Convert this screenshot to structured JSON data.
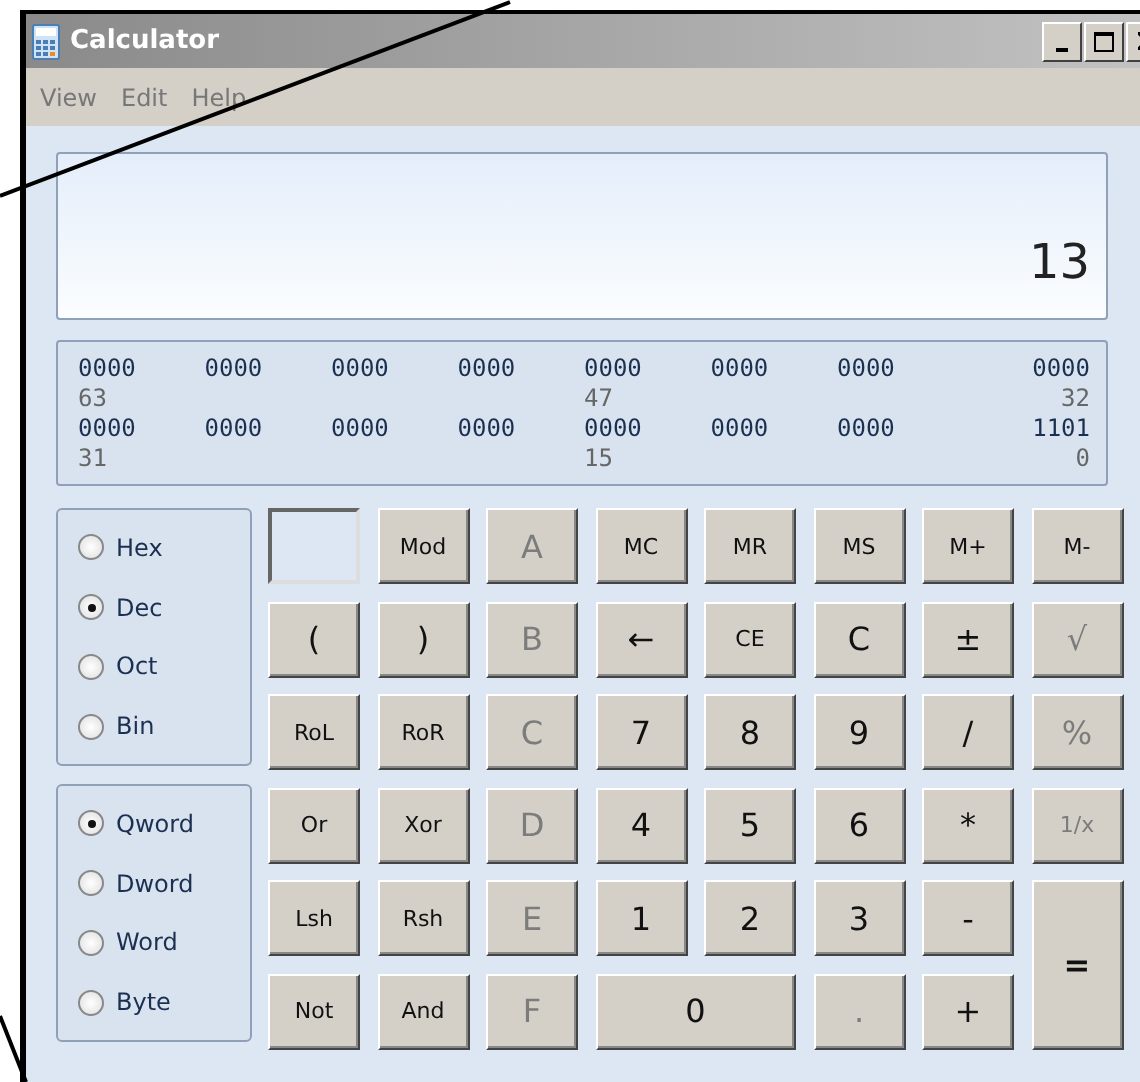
{
  "window": {
    "title": "Calculator"
  },
  "menu": [
    "View",
    "Edit",
    "Help"
  ],
  "display": {
    "value": "13"
  },
  "binary": [
    {
      "groups": [
        "0000",
        "0000",
        "0000",
        "0000",
        "0000",
        "0000",
        "0000",
        "0000"
      ],
      "positions": [
        "63",
        "47",
        "32"
      ]
    },
    {
      "groups": [
        "0000",
        "0000",
        "0000",
        "0000",
        "0000",
        "0000",
        "0000",
        "1101"
      ],
      "positions": [
        "31",
        "15",
        "0"
      ]
    }
  ],
  "base": [
    {
      "label": "Hex",
      "selected": false
    },
    {
      "label": "Dec",
      "selected": true
    },
    {
      "label": "Oct",
      "selected": false
    },
    {
      "label": "Bin",
      "selected": false
    }
  ],
  "word_size": [
    {
      "label": "Qword",
      "selected": true
    },
    {
      "label": "Dword",
      "selected": false
    },
    {
      "label": "Word",
      "selected": false
    },
    {
      "label": "Byte",
      "selected": false
    }
  ],
  "keys": [
    {
      "kind": "indicator"
    },
    {
      "kind": "key",
      "label": "Mod",
      "disabled": false
    },
    {
      "kind": "key",
      "label": "A",
      "disabled": true
    },
    {
      "kind": "key",
      "label": "MC",
      "disabled": false
    },
    {
      "kind": "key",
      "label": "MR",
      "disabled": false
    },
    {
      "kind": "key",
      "label": "MS",
      "disabled": false
    },
    {
      "kind": "key",
      "label": "M+",
      "disabled": false
    },
    {
      "kind": "key",
      "label": "M-",
      "disabled": false
    },
    {
      "kind": "key",
      "label": "(",
      "disabled": false
    },
    {
      "kind": "key",
      "label": ")",
      "disabled": false
    },
    {
      "kind": "key",
      "label": "B",
      "disabled": true
    },
    {
      "kind": "key",
      "label": "←",
      "disabled": false
    },
    {
      "kind": "key",
      "label": "CE",
      "disabled": false
    },
    {
      "kind": "key",
      "label": "C",
      "disabled": false
    },
    {
      "kind": "key",
      "label": "±",
      "disabled": false
    },
    {
      "kind": "key",
      "label": "√",
      "disabled": true
    },
    {
      "kind": "key",
      "label": "RoL",
      "disabled": false
    },
    {
      "kind": "key",
      "label": "RoR",
      "disabled": false
    },
    {
      "kind": "key",
      "label": "C",
      "disabled": true
    },
    {
      "kind": "key",
      "label": "7",
      "disabled": false
    },
    {
      "kind": "key",
      "label": "8",
      "disabled": false
    },
    {
      "kind": "key",
      "label": "9",
      "disabled": false
    },
    {
      "kind": "key",
      "label": "/",
      "disabled": false
    },
    {
      "kind": "key",
      "label": "%",
      "disabled": true
    },
    {
      "kind": "key",
      "label": "Or",
      "disabled": false
    },
    {
      "kind": "key",
      "label": "Xor",
      "disabled": false
    },
    {
      "kind": "key",
      "label": "D",
      "disabled": true
    },
    {
      "kind": "key",
      "label": "4",
      "disabled": false
    },
    {
      "kind": "key",
      "label": "5",
      "disabled": false
    },
    {
      "kind": "key",
      "label": "6",
      "disabled": false
    },
    {
      "kind": "key",
      "label": "*",
      "disabled": false
    },
    {
      "kind": "key",
      "label": "1/x",
      "disabled": true
    },
    {
      "kind": "key",
      "label": "Lsh",
      "disabled": false
    },
    {
      "kind": "key",
      "label": "Rsh",
      "disabled": false
    },
    {
      "kind": "key",
      "label": "E",
      "disabled": true
    },
    {
      "kind": "key",
      "label": "1",
      "disabled": false
    },
    {
      "kind": "key",
      "label": "2",
      "disabled": false
    },
    {
      "kind": "key",
      "label": "3",
      "disabled": false
    },
    {
      "kind": "key",
      "label": "-",
      "disabled": false
    },
    {
      "kind": "tall",
      "label": "=",
      "disabled": false
    },
    {
      "kind": "key",
      "label": "Not",
      "disabled": false
    },
    {
      "kind": "key",
      "label": "And",
      "disabled": false
    },
    {
      "kind": "key",
      "label": "F",
      "disabled": true
    },
    {
      "kind": "wide",
      "label": "0",
      "disabled": false
    },
    {
      "kind": "key",
      "label": ".",
      "disabled": true
    },
    {
      "kind": "key",
      "label": "+",
      "disabled": false
    }
  ]
}
